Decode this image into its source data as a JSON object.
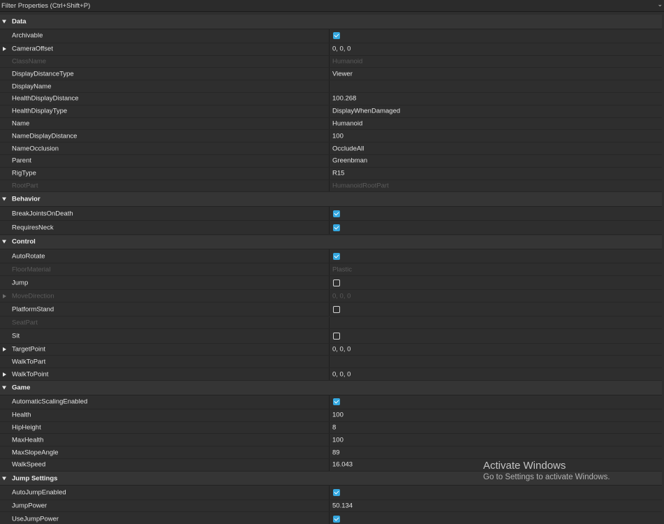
{
  "filter": {
    "placeholder": "Filter Properties (Ctrl+Shift+P)",
    "chevron": "⌄"
  },
  "rows": [
    {
      "kind": "category",
      "label": "Data"
    },
    {
      "kind": "prop",
      "name": "Archivable",
      "type": "bool",
      "checked": true
    },
    {
      "kind": "prop",
      "name": "CameraOffset",
      "value": "0, 0, 0",
      "expandable": true
    },
    {
      "kind": "prop",
      "name": "ClassName",
      "value": "Humanoid",
      "disabled": true
    },
    {
      "kind": "prop",
      "name": "DisplayDistanceType",
      "value": "Viewer"
    },
    {
      "kind": "prop",
      "name": "DisplayName",
      "value": ""
    },
    {
      "kind": "prop",
      "name": "HealthDisplayDistance",
      "value": "100.268"
    },
    {
      "kind": "prop",
      "name": "HealthDisplayType",
      "value": "DisplayWhenDamaged"
    },
    {
      "kind": "prop",
      "name": "Name",
      "value": "Humanoid"
    },
    {
      "kind": "prop",
      "name": "NameDisplayDistance",
      "value": "100"
    },
    {
      "kind": "prop",
      "name": "NameOcclusion",
      "value": "OccludeAll"
    },
    {
      "kind": "prop",
      "name": "Parent",
      "value": "Greenbman"
    },
    {
      "kind": "prop",
      "name": "RigType",
      "value": "R15"
    },
    {
      "kind": "prop",
      "name": "RootPart",
      "value": "HumanoidRootPart",
      "disabled": true
    },
    {
      "kind": "category",
      "label": "Behavior"
    },
    {
      "kind": "prop",
      "name": "BreakJointsOnDeath",
      "type": "bool",
      "checked": true
    },
    {
      "kind": "prop",
      "name": "RequiresNeck",
      "type": "bool",
      "checked": true
    },
    {
      "kind": "category",
      "label": "Control"
    },
    {
      "kind": "prop",
      "name": "AutoRotate",
      "type": "bool",
      "checked": true
    },
    {
      "kind": "prop",
      "name": "FloorMaterial",
      "value": "Plastic",
      "disabled": true
    },
    {
      "kind": "prop",
      "name": "Jump",
      "type": "bool",
      "checked": false
    },
    {
      "kind": "prop",
      "name": "MoveDirection",
      "value": "0, 0, 0",
      "disabled": true,
      "expandable": true
    },
    {
      "kind": "prop",
      "name": "PlatformStand",
      "type": "bool",
      "checked": false
    },
    {
      "kind": "prop",
      "name": "SeatPart",
      "value": "",
      "disabled": true
    },
    {
      "kind": "prop",
      "name": "Sit",
      "type": "bool",
      "checked": false
    },
    {
      "kind": "prop",
      "name": "TargetPoint",
      "value": "0, 0, 0",
      "expandable": true
    },
    {
      "kind": "prop",
      "name": "WalkToPart",
      "value": ""
    },
    {
      "kind": "prop",
      "name": "WalkToPoint",
      "value": "0, 0, 0",
      "expandable": true
    },
    {
      "kind": "category",
      "label": "Game"
    },
    {
      "kind": "prop",
      "name": "AutomaticScalingEnabled",
      "type": "bool",
      "checked": true
    },
    {
      "kind": "prop",
      "name": "Health",
      "value": "100"
    },
    {
      "kind": "prop",
      "name": "HipHeight",
      "value": "8"
    },
    {
      "kind": "prop",
      "name": "MaxHealth",
      "value": "100"
    },
    {
      "kind": "prop",
      "name": "MaxSlopeAngle",
      "value": "89"
    },
    {
      "kind": "prop",
      "name": "WalkSpeed",
      "value": "16.043"
    },
    {
      "kind": "category",
      "label": "Jump Settings"
    },
    {
      "kind": "prop",
      "name": "AutoJumpEnabled",
      "type": "bool",
      "checked": true
    },
    {
      "kind": "prop",
      "name": "JumpPower",
      "value": "50.134"
    },
    {
      "kind": "prop",
      "name": "UseJumpPower",
      "type": "bool",
      "checked": true
    }
  ],
  "watermark": {
    "title": "Activate Windows",
    "subtitle": "Go to Settings to activate Windows."
  },
  "colors": {
    "checkbox_on": "#35a8e0",
    "background": "#2e2e2e",
    "category_bg": "#353535"
  }
}
